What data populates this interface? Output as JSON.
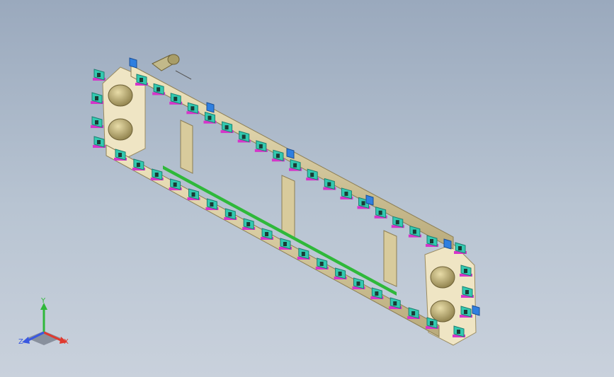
{
  "viewport": {
    "background_top": "#9aa9bd",
    "background_bottom": "#c9d1dc"
  },
  "model": {
    "description": "conveyor",
    "colors": {
      "frame": "#e6d9ae",
      "frame_dark": "#a99c72",
      "carriers": "#33c9b0",
      "carriers_dark": "#1d7f70",
      "chain_link": "#d535c9",
      "brackets": "#2f7fe0",
      "green_rail": "#2fb83a",
      "end_plate": "#efe5c4",
      "roller": "#bdae6e"
    }
  },
  "triad": {
    "x_label": "X",
    "y_label": "Y",
    "z_label": "Z",
    "x_color": "#e03a2f",
    "y_color": "#2fb83a",
    "z_color": "#3a58e0"
  }
}
